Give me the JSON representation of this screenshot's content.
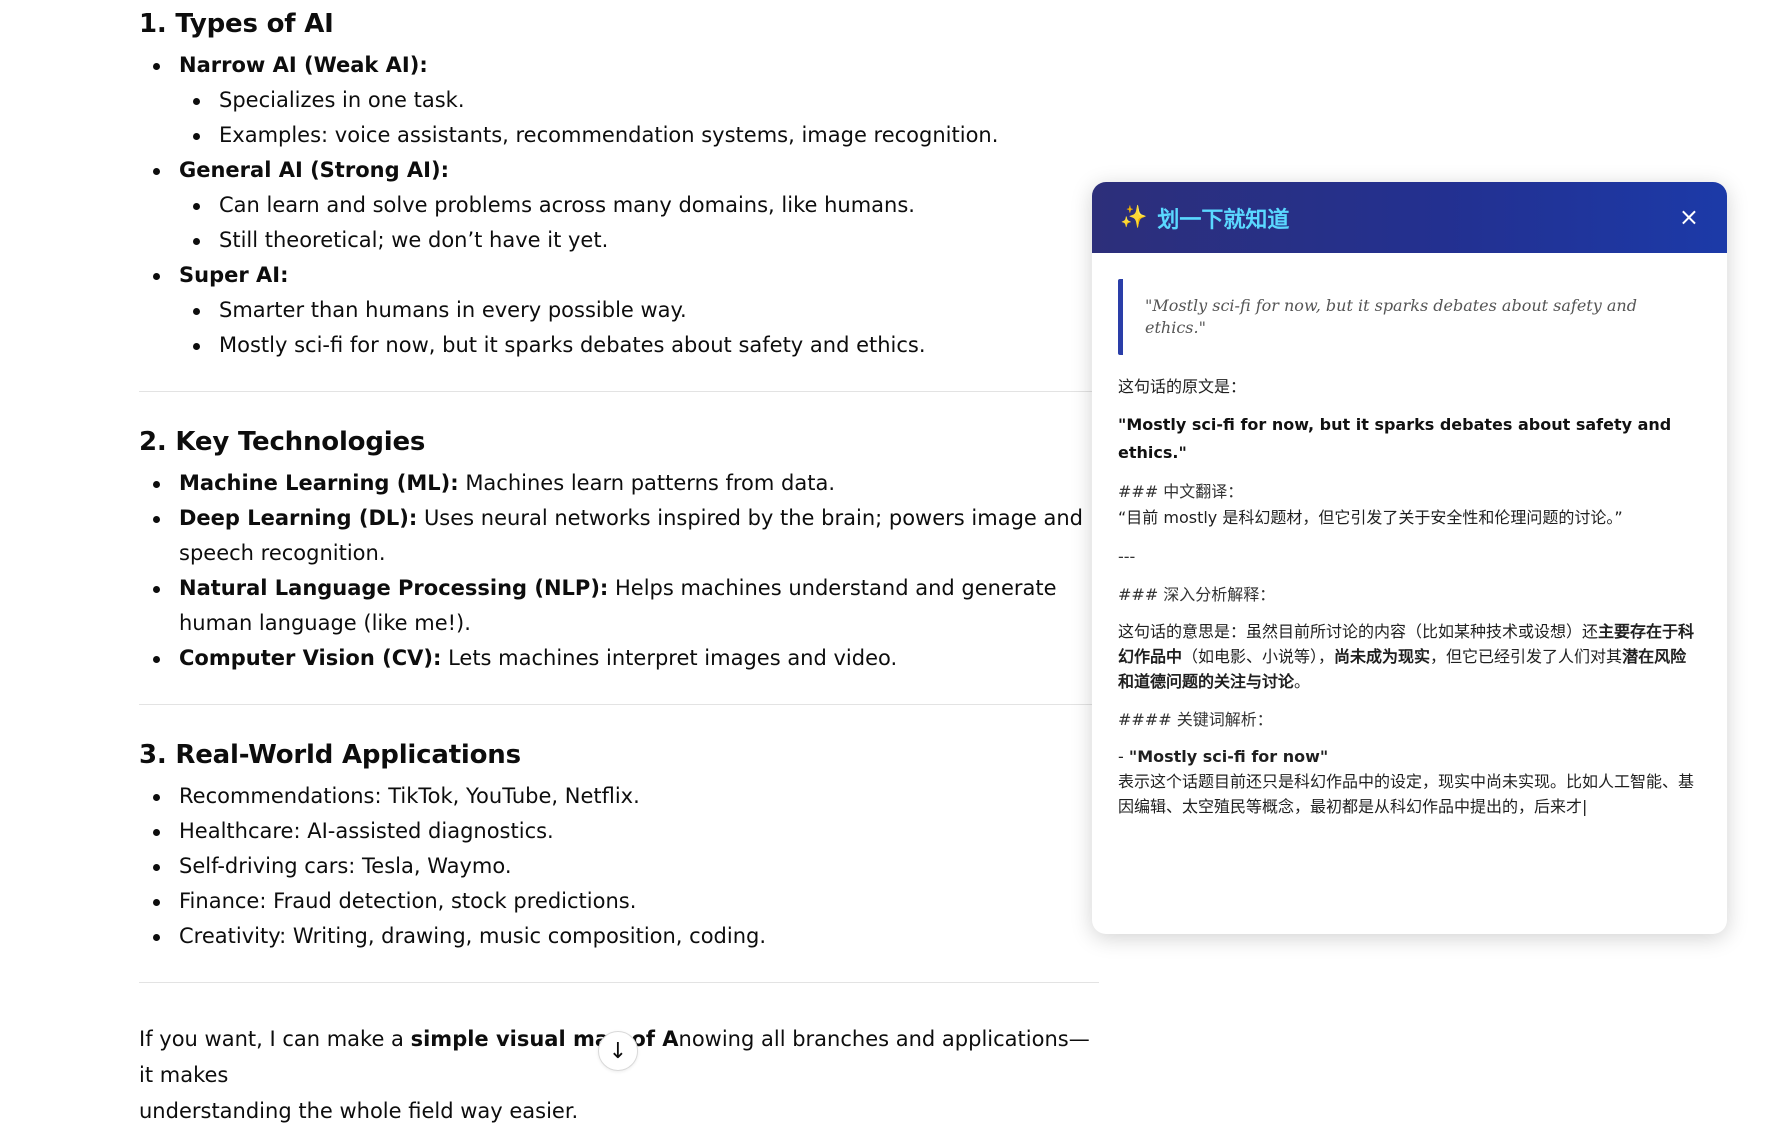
{
  "sections": {
    "s1": {
      "title": "1. Types of AI",
      "items": [
        {
          "label": "Narrow AI (Weak AI):",
          "sub": [
            "Specializes in one task.",
            "Examples: voice assistants, recommendation systems, image recognition."
          ]
        },
        {
          "label": "General AI (Strong AI):",
          "sub": [
            "Can learn and solve problems across many domains, like humans.",
            "Still theoretical; we don’t have it yet."
          ]
        },
        {
          "label": "Super AI:",
          "sub": [
            "Smarter than humans in every possible way.",
            "Mostly sci-fi for now, but it sparks debates about safety and ethics."
          ]
        }
      ]
    },
    "s2": {
      "title": "2. Key Technologies",
      "items": [
        {
          "label": "Machine Learning (ML):",
          "text": " Machines learn patterns from data."
        },
        {
          "label": "Deep Learning (DL):",
          "text": " Uses neural networks inspired by the brain; powers image and speech recognition."
        },
        {
          "label": "Natural Language Processing (NLP):",
          "text": " Helps machines understand and generate human language (like me!)."
        },
        {
          "label": "Computer Vision (CV):",
          "text": " Lets machines interpret images and video."
        }
      ]
    },
    "s3": {
      "title": "3. Real-World Applications",
      "items": [
        "Recommendations: TikTok, YouTube, Netflix.",
        "Healthcare: AI-assisted diagnostics.",
        "Self-driving cars: Tesla, Waymo.",
        "Finance: Fraud detection, stock predictions.",
        "Creativity: Writing, drawing, music composition, coding."
      ]
    },
    "closing": {
      "pre": "If you want, I can make a ",
      "bold": "simple visual map of A",
      "post": "nowing all branches and applications—it makes",
      "line2": "understanding the whole field way easier."
    }
  },
  "scroll_icon": "arrow-down-icon",
  "panel": {
    "title": "划一下就知道",
    "icon": "sparkles-icon",
    "close_label": "×",
    "quote": "\"Mostly sci-fi for now, but it sparks debates about safety and ethics.\"",
    "orig_label": "这句话的原文是：",
    "orig_text": "\"Mostly sci-fi for now, but it sparks debates about safety and ethics.\"",
    "trans_heading": "### 中文翻译：",
    "trans_text": "“目前 mostly 是科幻题材，但它引发了关于安全性和伦理问题的讨论。”",
    "separator": "---",
    "analysis_heading": "### 深入分析解释：",
    "analysis_a": "这句话的意思是：虽然目前所讨论的内容（比如某种技术或设想）还",
    "analysis_b": "主要存在于科幻作品中",
    "analysis_c": "（如电影、小说等），",
    "analysis_d": "尚未成为现实",
    "analysis_e": "，但它已经引发了人们对其",
    "analysis_f": "潜在风险和道德问题的关注与讨论",
    "analysis_g": "。",
    "keyword_heading": "#### 关键词解析：",
    "kw_dash": "- ",
    "kw_term": "\"Mostly sci-fi for now\"",
    "kw_text": "表示这个话题目前还只是科幻作品中的设定，现实中尚未实现。比如人工智能、基因编辑、太空殖民等概念，最初都是从科幻作品中提出的，后来才|"
  },
  "colors": {
    "header_start": "#2d2f7a",
    "header_end": "#1c3aa8",
    "title_cyan": "#5ad8ff",
    "quote_bar": "#2a3ea8"
  }
}
